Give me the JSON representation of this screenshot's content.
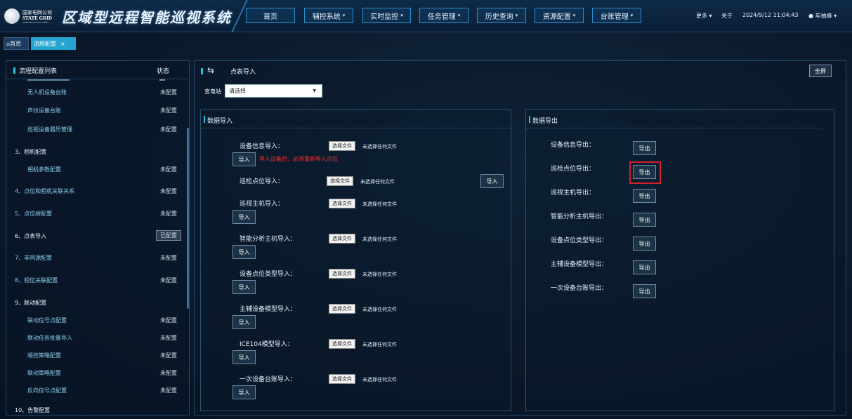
{
  "header": {
    "logo_line1": "国家电网公司",
    "logo_line2": "STATE GRID",
    "logo_line3": "CORPORATION OF CHINA",
    "system_title": "区域型远程智能巡视系统",
    "nav": [
      {
        "label": "首页",
        "caret": false
      },
      {
        "label": "辅控系统",
        "caret": true
      },
      {
        "label": "实时监控",
        "caret": true
      },
      {
        "label": "任务管理",
        "caret": true
      },
      {
        "label": "历史查询",
        "caret": true
      },
      {
        "label": "资源配置",
        "caret": true
      },
      {
        "label": "台账管理",
        "caret": true
      }
    ],
    "more": "更多",
    "about": "关于",
    "datetime": "2024/9/12 11:04:43",
    "user": "车抽峰"
  },
  "tabs": {
    "home": "首页",
    "active": "流程配置"
  },
  "left": {
    "title": "流程配置列表",
    "status_header": "状态",
    "rows": [
      {
        "label": "无人机设备台账",
        "kind": "sub",
        "status": "未配置"
      },
      {
        "label": "声纹设备台账",
        "kind": "sub",
        "status": "未配置"
      },
      {
        "label": "巡视设备履历管理",
        "kind": "sub",
        "status": "未配置"
      },
      {
        "label": "3、相机配置",
        "kind": "section",
        "status": ""
      },
      {
        "label": "相机参数配置",
        "kind": "sub",
        "status": "未配置"
      },
      {
        "label": "4、点位和相机关联关系",
        "kind": "sectionlink",
        "status": "未配置"
      },
      {
        "label": "5、点位树配置",
        "kind": "sectionlink",
        "status": "未配置"
      },
      {
        "label": "6、点表导入",
        "kind": "section",
        "status": "已配置"
      },
      {
        "label": "7、非同源配置",
        "kind": "sectionlink",
        "status": "未配置"
      },
      {
        "label": "8、相位关联配置",
        "kind": "sectionlink",
        "status": "未配置"
      },
      {
        "label": "9、联动配置",
        "kind": "section",
        "status": ""
      },
      {
        "label": "联动信号点配置",
        "kind": "sub",
        "status": "未配置"
      },
      {
        "label": "联动任务批量导入",
        "kind": "sub",
        "status": "未配置"
      },
      {
        "label": "顺控策略配置",
        "kind": "sub",
        "status": "未配置"
      },
      {
        "label": "联动策略配置",
        "kind": "sub",
        "status": "未配置"
      },
      {
        "label": "反向信号点配置",
        "kind": "sub",
        "status": "未配置"
      },
      {
        "label": "10、告警配置",
        "kind": "section",
        "status": ""
      }
    ]
  },
  "main": {
    "title": "点表导入",
    "fullscreen": "全屏",
    "station_label": "变电站",
    "station_value": "请选择",
    "import": {
      "heading": "数据导入",
      "choose_file": "选择文件",
      "no_file": "未选择任何文件",
      "import_btn": "导入",
      "warning": "导入设备后，必须重新导入点位",
      "rows": [
        "设备信息导入：",
        "巡检点位导入：",
        "巡视主机导入：",
        "智能分析主机导入：",
        "设备点位类型导入：",
        "主辅设备模型导入：",
        "ICE104模型导入：",
        "一次设备台账导入："
      ]
    },
    "export": {
      "heading": "数据导出",
      "export_btn": "导出",
      "rows": [
        "设备信息导出：",
        "巡检点位导出：",
        "巡视主机导出：",
        "智能分析主机导出：",
        "设备点位类型导出：",
        "主辅设备模型导出：",
        "一次设备台账导出："
      ]
    }
  }
}
